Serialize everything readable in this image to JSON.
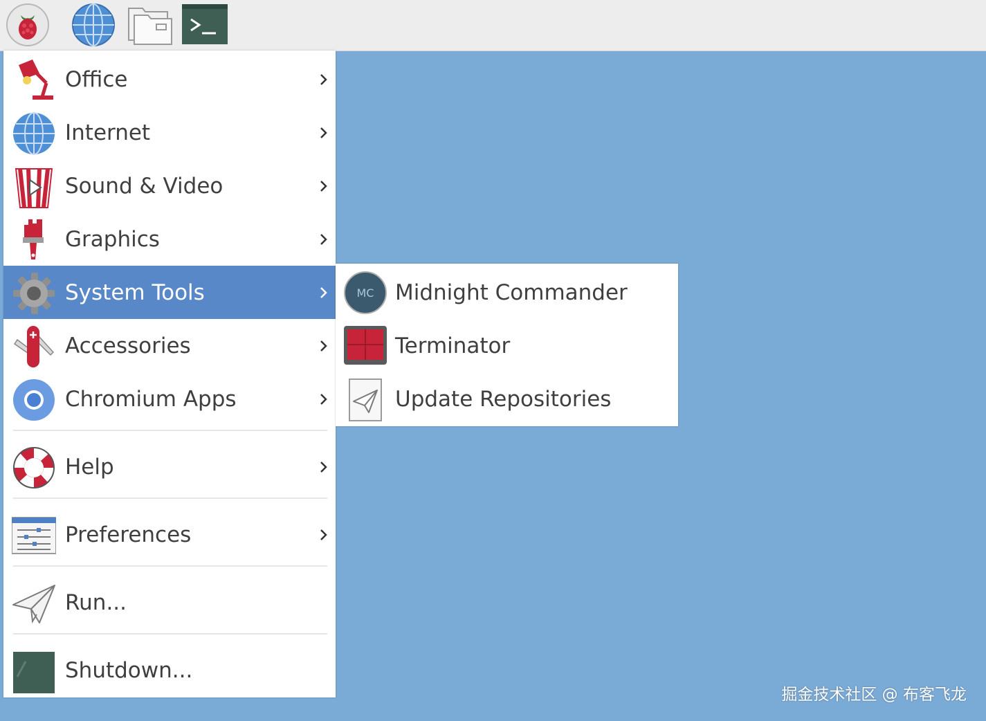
{
  "taskbar": {
    "buttons": [
      {
        "icon": "raspberry-menu-icon"
      },
      {
        "icon": "globe-browser-icon"
      },
      {
        "icon": "file-manager-folder-icon"
      },
      {
        "icon": "terminal-icon"
      }
    ]
  },
  "main_menu": {
    "items": [
      {
        "label": "Office",
        "icon": "office-lamp-icon",
        "has_submenu": true
      },
      {
        "label": "Internet",
        "icon": "globe-icon",
        "has_submenu": true
      },
      {
        "label": "Sound & Video",
        "icon": "popcorn-video-icon",
        "has_submenu": true
      },
      {
        "label": "Graphics",
        "icon": "paintbrush-icon",
        "has_submenu": true
      },
      {
        "label": "System Tools",
        "icon": "gear-icon",
        "has_submenu": true,
        "active": true
      },
      {
        "label": "Accessories",
        "icon": "swiss-knife-icon",
        "has_submenu": true
      },
      {
        "label": "Chromium Apps",
        "icon": "chromium-icon",
        "has_submenu": true
      },
      {
        "label": "Help",
        "icon": "lifebuoy-icon",
        "has_submenu": true
      },
      {
        "label": "Preferences",
        "icon": "sliders-icon",
        "has_submenu": true
      },
      {
        "label": "Run...",
        "icon": "paper-plane-icon",
        "has_submenu": false
      },
      {
        "label": "Shutdown...",
        "icon": "shutdown-icon",
        "has_submenu": false
      }
    ]
  },
  "system_tools_submenu": {
    "items": [
      {
        "label": "Midnight Commander",
        "icon": "midnight-commander-icon"
      },
      {
        "label": "Terminator",
        "icon": "terminator-icon"
      },
      {
        "label": "Update Repositories",
        "icon": "update-repositories-icon"
      }
    ]
  },
  "watermark": "掘金技术社区 @ 布客飞龙",
  "colors": {
    "desktop": "#7aaad6",
    "menu_highlight": "#5888c8",
    "menu_text": "#3f3f3f",
    "taskbar": "#ededed"
  }
}
